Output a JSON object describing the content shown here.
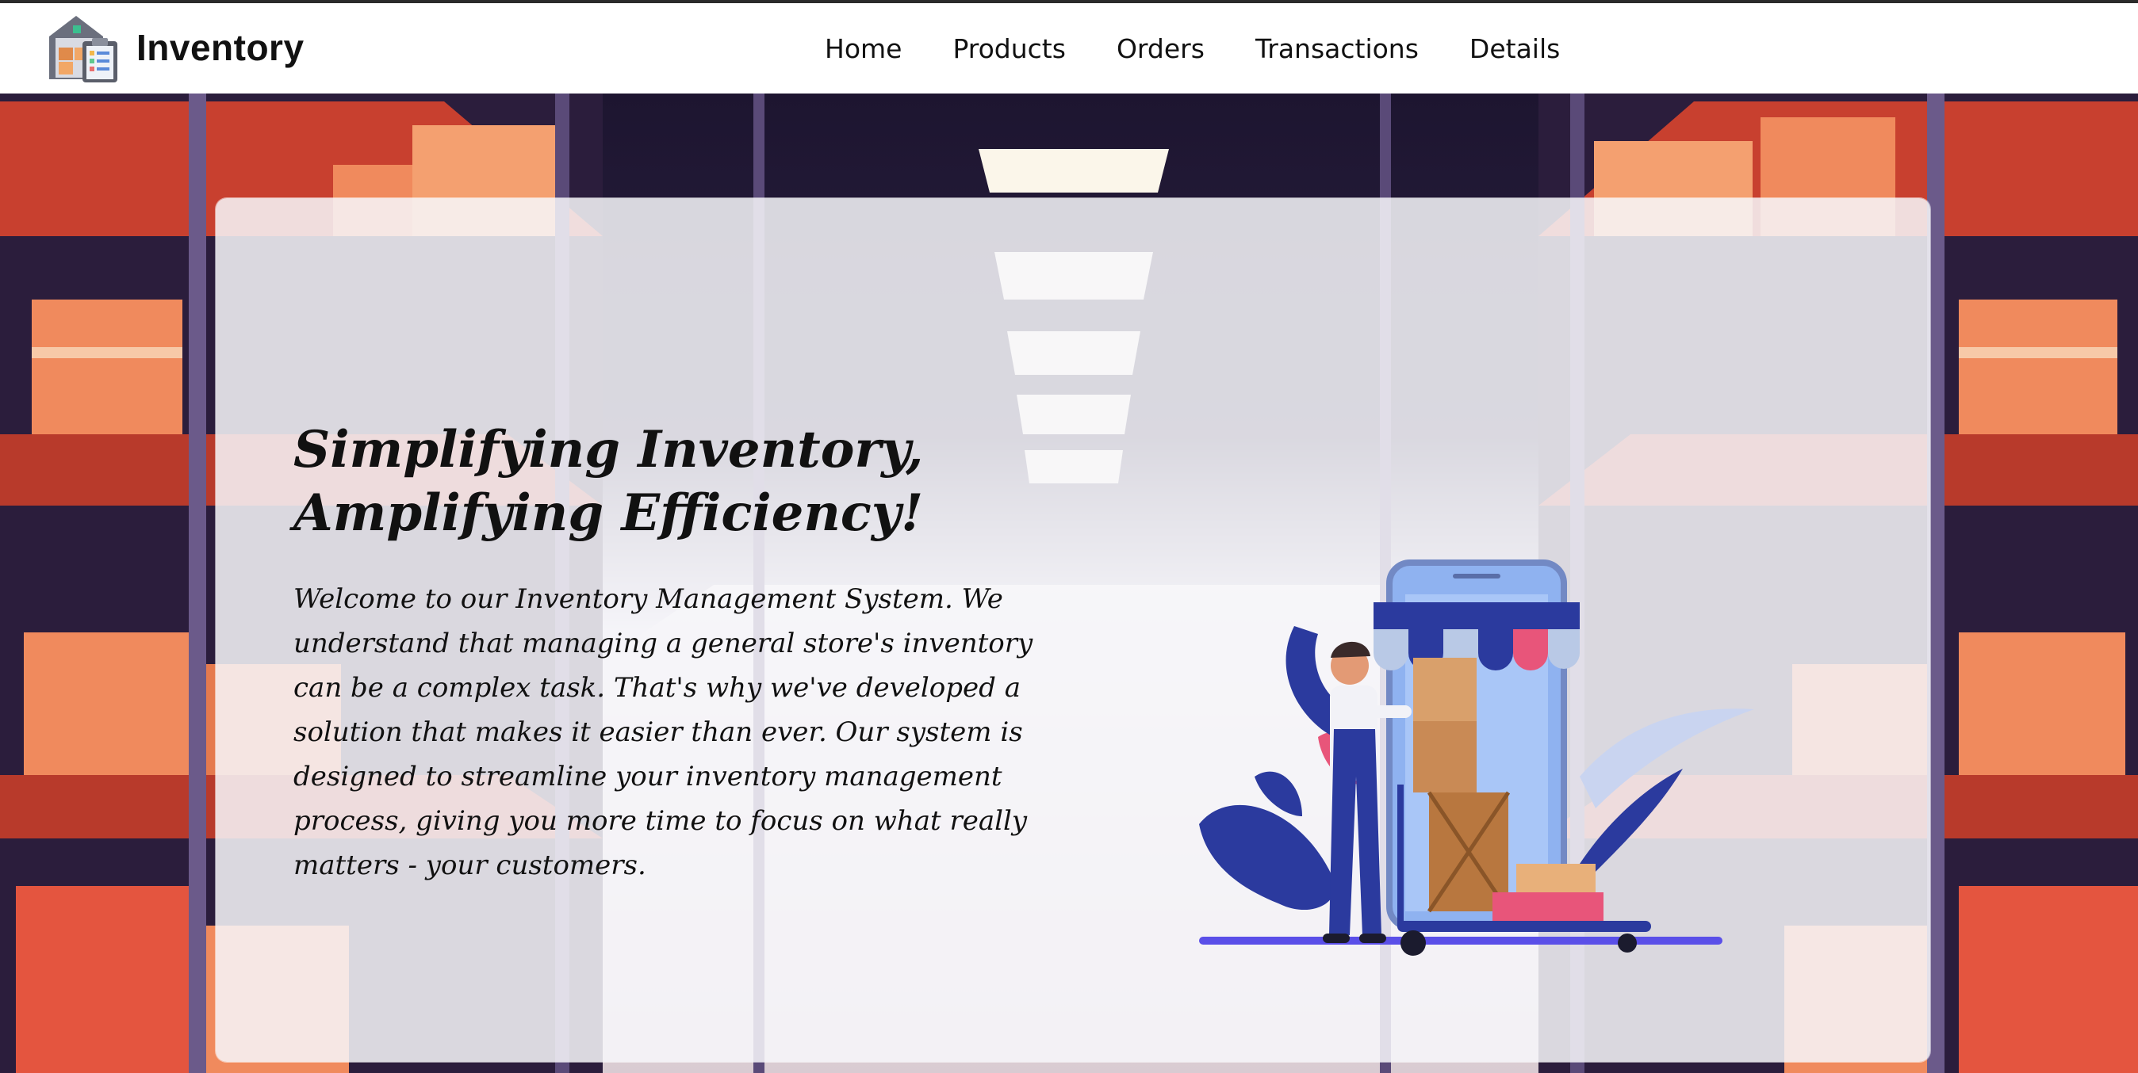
{
  "brand": {
    "name": "Inventory",
    "logo_icon": "warehouse-clipboard-icon"
  },
  "nav": {
    "items": [
      {
        "label": "Home"
      },
      {
        "label": "Products"
      },
      {
        "label": "Orders"
      },
      {
        "label": "Transactions"
      },
      {
        "label": "Details"
      }
    ]
  },
  "hero": {
    "headline_line1": "Simplifying Inventory,",
    "headline_line2": "Amplifying Efficiency!",
    "intro": "Welcome to our Inventory Management System. We understand that managing a general store's inventory can be a complex task. That's why we've developed a solution that makes it easier than ever. Our system is designed to streamline your inventory management process, giving you more time to focus on what really matters - your customers.",
    "background": "warehouse-shelves-illustration",
    "illustration": "delivery-worker-phone-store-illustration"
  },
  "colors": {
    "nav_bg": "#ffffff",
    "shelf_red": "#c8402f",
    "box_orange": "#f08a5d",
    "accent_blue": "#2b3a9e",
    "card_overlay": "#f7f7fa"
  }
}
